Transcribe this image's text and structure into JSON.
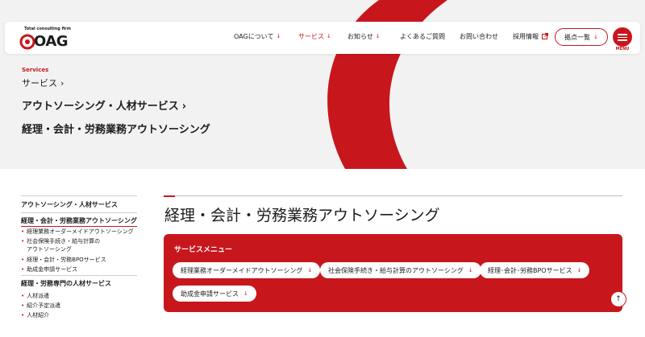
{
  "header": {
    "logo_tagline": "Total consulting firm",
    "logo_text": "OAG",
    "nav": [
      {
        "label": "OAGについて"
      },
      {
        "label": "サービス"
      },
      {
        "label": "お知らせ"
      },
      {
        "label": "よくあるご質問"
      },
      {
        "label": "お問い合わせ"
      },
      {
        "label": "採用情報"
      }
    ],
    "locations_label": "拠点一覧",
    "menu_label": "MENU"
  },
  "breadcrumb": {
    "section_en": "Services",
    "level1": "サービス",
    "level2": "アウトソーシング・人材サービス",
    "level3": "経理・会計・労務業務アウトソーシング"
  },
  "sidebar": {
    "group1": "アウトソーシング・人材サービス",
    "group1_sub": "経理・会計・労務業務アウトソーシング",
    "items1": [
      "経理業務オーダーメイドアウトソーシング",
      "社会保険手続き・給与計算の",
      "アウトソーシング",
      "経理・会計・労務BPOサービス",
      "助成金申請サービス"
    ],
    "group2": "経理・労務専門の人材サービス",
    "items2": [
      "人材派遣",
      "紹介予定派遣",
      "人材紹介"
    ]
  },
  "main": {
    "title": "経理・会計・労務業務アウトソーシング",
    "menu_title": "サービスメニュー",
    "pills": [
      "経理業務オーダーメイドアウトソーシング",
      "社会保険手続き・給与計算のアウトソーシング",
      "経理･会計･労務BPOサービス",
      "助成金申請サービス"
    ]
  },
  "colors": {
    "accent": "#c8161d",
    "hero_bg": "#f2f2f2"
  },
  "icons": {
    "arrow": "down-arrow-icon",
    "external": "external-link-icon",
    "chevron": "chevron-right-icon",
    "menu": "hamburger-icon",
    "top": "back-to-top-icon"
  }
}
